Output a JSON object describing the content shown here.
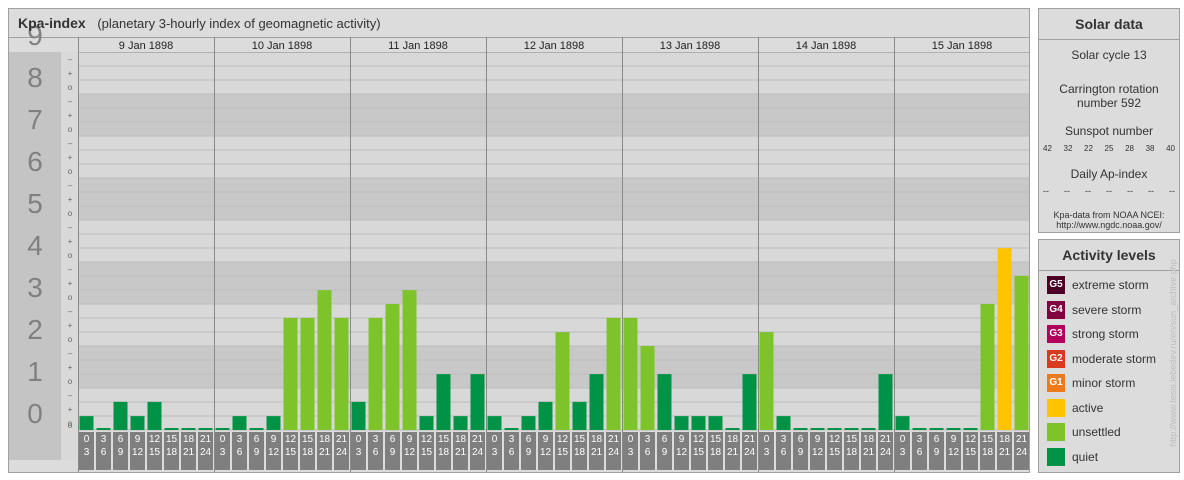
{
  "header": {
    "title": "Kpa-index",
    "subtitle": "(planetary 3-hourly index of geomagnetic activity)"
  },
  "chart_data": {
    "type": "bar",
    "ylim": [
      0,
      9
    ],
    "y_ticks": [
      "0",
      "1",
      "2",
      "3",
      "4",
      "5",
      "6",
      "7",
      "8",
      "9"
    ],
    "minor_tick_labels": [
      "o",
      "+",
      "–"
    ],
    "days": [
      "9 Jan 1898",
      "10 Jan 1898",
      "11 Jan 1898",
      "12 Jan 1898",
      "13 Jan 1898",
      "14 Jan 1898",
      "15 Jan 1898"
    ],
    "interval_starts": [
      "0",
      "3",
      "6",
      "9",
      "12",
      "15",
      "18",
      "21"
    ],
    "interval_ends": [
      "3",
      "6",
      "9",
      "12",
      "15",
      "18",
      "21",
      "24"
    ],
    "values": [
      0.33,
      0,
      0.67,
      0.33,
      0.67,
      0,
      0,
      0,
      0,
      0.33,
      0,
      0.33,
      2.67,
      2.67,
      3.33,
      2.67,
      0.67,
      2.67,
      3,
      3.33,
      0.33,
      1.33,
      0.33,
      1.33,
      0.33,
      0,
      0.33,
      0.67,
      2.33,
      0.67,
      1.33,
      2.67,
      2.67,
      2,
      1.33,
      0.33,
      0.33,
      0.33,
      0,
      1.33,
      2.33,
      0.33,
      0,
      0,
      0,
      0,
      0,
      1.33,
      0.33,
      0,
      0,
      0,
      0,
      3,
      4.33,
      3.67
    ],
    "level_colors": {
      "quiet": "#009245",
      "unsettled": "#7dc42b",
      "active": "#ffc300"
    }
  },
  "solar": {
    "title": "Solar data",
    "cycle": "Solar cycle 13",
    "carrington_line1": "Carrington rotation",
    "carrington_line2": "number 592",
    "sunspot_label": "Sunspot number",
    "sunspot_values": [
      "42",
      "32",
      "22",
      "25",
      "28",
      "38",
      "40"
    ],
    "ap_label": "Daily Ap-index",
    "ap_values": [
      "--",
      "--",
      "--",
      "--",
      "--",
      "--",
      "--"
    ],
    "source_line1": "Kpa-data from NOAA NCEI:",
    "source_line2": "http://www.ngdc.noaa.gov/"
  },
  "activity": {
    "title": "Activity levels",
    "levels": [
      {
        "badge": "G5",
        "label": "extreme storm",
        "color": "#4d0026"
      },
      {
        "badge": "G4",
        "label": "severe storm",
        "color": "#800040"
      },
      {
        "badge": "G3",
        "label": "strong storm",
        "color": "#b0005a"
      },
      {
        "badge": "G2",
        "label": "moderate storm",
        "color": "#d93a1f"
      },
      {
        "badge": "G1",
        "label": "minor storm",
        "color": "#ee7b1a"
      },
      {
        "badge": "",
        "label": "active",
        "color": "#ffc300"
      },
      {
        "badge": "",
        "label": "unsettled",
        "color": "#7dc42b"
      },
      {
        "badge": "",
        "label": "quiet",
        "color": "#009245"
      }
    ]
  },
  "website": "http://www.tesis.lebedev.ru/en/sun_archive.php"
}
